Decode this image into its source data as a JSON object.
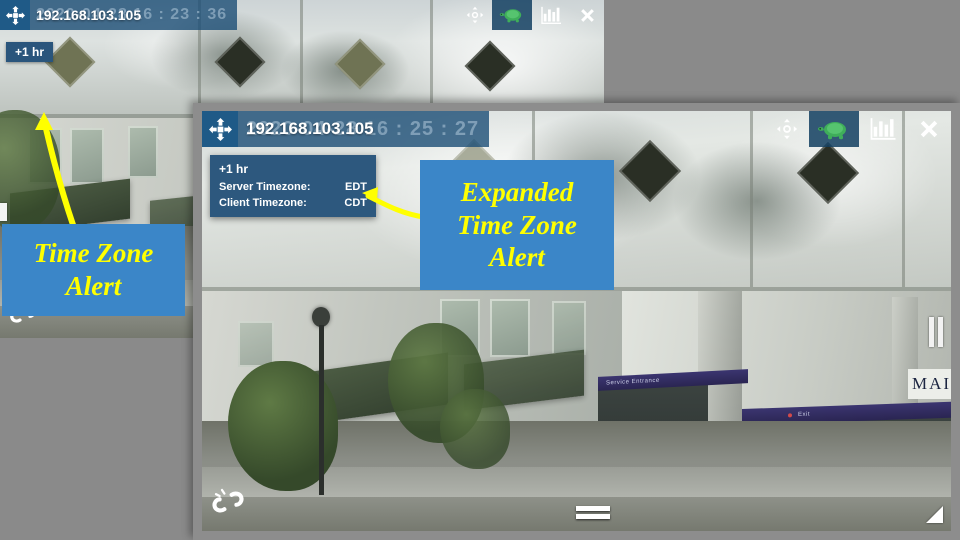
{
  "app": {
    "accent_blue": "#2a557c",
    "callout_bg": "#3b86c8",
    "callout_text_color": "#ffff00",
    "desktop_bg": "#8a8a8a"
  },
  "window_back": {
    "title_ip": "192.168.103.105",
    "title_datetime": "2020-04-28 16 : 23 : 36",
    "toolbar": [
      {
        "name": "pan-icon",
        "label": "Pan / Move",
        "active": false
      },
      {
        "name": "turtle-icon",
        "label": "Slow Motion",
        "active": true
      },
      {
        "name": "bar-chart-icon",
        "label": "Statistics",
        "active": false
      },
      {
        "name": "close-icon",
        "label": "Close",
        "active": false
      }
    ],
    "tz_badge": "+1 hr",
    "unlink_icon_label": "Unlink Stream"
  },
  "window_front": {
    "title_ip": "192.168.103.105",
    "title_datetime": "2020-04-28 16 : 25 : 27",
    "toolbar": [
      {
        "name": "pan-icon",
        "label": "Pan / Move",
        "active": false
      },
      {
        "name": "turtle-icon",
        "label": "Slow Motion",
        "active": true
      },
      {
        "name": "bar-chart-icon",
        "label": "Statistics",
        "active": false
      },
      {
        "name": "close-icon",
        "label": "Close",
        "active": false
      }
    ],
    "tz_panel": {
      "header": "+1 hr",
      "rows": [
        {
          "label": "Server Timezone:",
          "value": "EDT"
        },
        {
          "label": "Client Timezone:",
          "value": "CDT"
        }
      ]
    },
    "unlink_icon_label": "Unlink Stream",
    "pause_label": "Pause",
    "menu_label": "Menu",
    "resize_label": "Resize"
  },
  "callouts": [
    {
      "name": "callout-time-zone-alert",
      "lines": [
        "Time Zone",
        "Alert"
      ]
    },
    {
      "name": "callout-expanded-time-zone-alert",
      "lines": [
        "Expanded",
        "Time Zone",
        "Alert"
      ]
    }
  ],
  "scene_signage": {
    "service_entrance": "Service Entrance",
    "exit": "Exit",
    "main": "MAIN"
  }
}
